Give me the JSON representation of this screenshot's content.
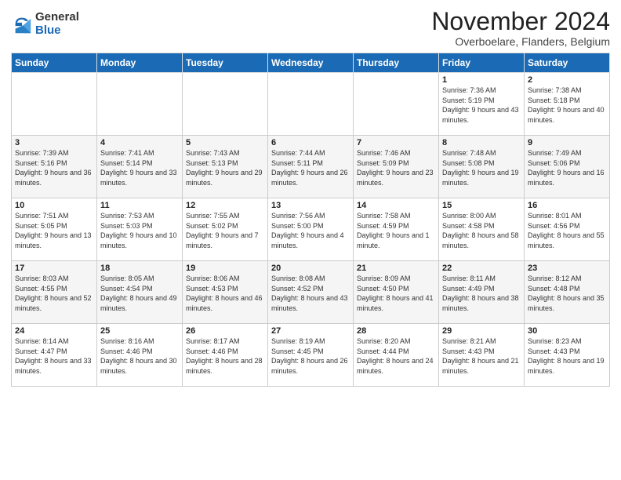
{
  "header": {
    "logo_general": "General",
    "logo_blue": "Blue",
    "title": "November 2024",
    "location": "Overboelare, Flanders, Belgium"
  },
  "days_of_week": [
    "Sunday",
    "Monday",
    "Tuesday",
    "Wednesday",
    "Thursday",
    "Friday",
    "Saturday"
  ],
  "weeks": [
    [
      {
        "day": "",
        "info": ""
      },
      {
        "day": "",
        "info": ""
      },
      {
        "day": "",
        "info": ""
      },
      {
        "day": "",
        "info": ""
      },
      {
        "day": "",
        "info": ""
      },
      {
        "day": "1",
        "info": "Sunrise: 7:36 AM\nSunset: 5:19 PM\nDaylight: 9 hours and 43 minutes."
      },
      {
        "day": "2",
        "info": "Sunrise: 7:38 AM\nSunset: 5:18 PM\nDaylight: 9 hours and 40 minutes."
      }
    ],
    [
      {
        "day": "3",
        "info": "Sunrise: 7:39 AM\nSunset: 5:16 PM\nDaylight: 9 hours and 36 minutes."
      },
      {
        "day": "4",
        "info": "Sunrise: 7:41 AM\nSunset: 5:14 PM\nDaylight: 9 hours and 33 minutes."
      },
      {
        "day": "5",
        "info": "Sunrise: 7:43 AM\nSunset: 5:13 PM\nDaylight: 9 hours and 29 minutes."
      },
      {
        "day": "6",
        "info": "Sunrise: 7:44 AM\nSunset: 5:11 PM\nDaylight: 9 hours and 26 minutes."
      },
      {
        "day": "7",
        "info": "Sunrise: 7:46 AM\nSunset: 5:09 PM\nDaylight: 9 hours and 23 minutes."
      },
      {
        "day": "8",
        "info": "Sunrise: 7:48 AM\nSunset: 5:08 PM\nDaylight: 9 hours and 19 minutes."
      },
      {
        "day": "9",
        "info": "Sunrise: 7:49 AM\nSunset: 5:06 PM\nDaylight: 9 hours and 16 minutes."
      }
    ],
    [
      {
        "day": "10",
        "info": "Sunrise: 7:51 AM\nSunset: 5:05 PM\nDaylight: 9 hours and 13 minutes."
      },
      {
        "day": "11",
        "info": "Sunrise: 7:53 AM\nSunset: 5:03 PM\nDaylight: 9 hours and 10 minutes."
      },
      {
        "day": "12",
        "info": "Sunrise: 7:55 AM\nSunset: 5:02 PM\nDaylight: 9 hours and 7 minutes."
      },
      {
        "day": "13",
        "info": "Sunrise: 7:56 AM\nSunset: 5:00 PM\nDaylight: 9 hours and 4 minutes."
      },
      {
        "day": "14",
        "info": "Sunrise: 7:58 AM\nSunset: 4:59 PM\nDaylight: 9 hours and 1 minute."
      },
      {
        "day": "15",
        "info": "Sunrise: 8:00 AM\nSunset: 4:58 PM\nDaylight: 8 hours and 58 minutes."
      },
      {
        "day": "16",
        "info": "Sunrise: 8:01 AM\nSunset: 4:56 PM\nDaylight: 8 hours and 55 minutes."
      }
    ],
    [
      {
        "day": "17",
        "info": "Sunrise: 8:03 AM\nSunset: 4:55 PM\nDaylight: 8 hours and 52 minutes."
      },
      {
        "day": "18",
        "info": "Sunrise: 8:05 AM\nSunset: 4:54 PM\nDaylight: 8 hours and 49 minutes."
      },
      {
        "day": "19",
        "info": "Sunrise: 8:06 AM\nSunset: 4:53 PM\nDaylight: 8 hours and 46 minutes."
      },
      {
        "day": "20",
        "info": "Sunrise: 8:08 AM\nSunset: 4:52 PM\nDaylight: 8 hours and 43 minutes."
      },
      {
        "day": "21",
        "info": "Sunrise: 8:09 AM\nSunset: 4:50 PM\nDaylight: 8 hours and 41 minutes."
      },
      {
        "day": "22",
        "info": "Sunrise: 8:11 AM\nSunset: 4:49 PM\nDaylight: 8 hours and 38 minutes."
      },
      {
        "day": "23",
        "info": "Sunrise: 8:12 AM\nSunset: 4:48 PM\nDaylight: 8 hours and 35 minutes."
      }
    ],
    [
      {
        "day": "24",
        "info": "Sunrise: 8:14 AM\nSunset: 4:47 PM\nDaylight: 8 hours and 33 minutes."
      },
      {
        "day": "25",
        "info": "Sunrise: 8:16 AM\nSunset: 4:46 PM\nDaylight: 8 hours and 30 minutes."
      },
      {
        "day": "26",
        "info": "Sunrise: 8:17 AM\nSunset: 4:46 PM\nDaylight: 8 hours and 28 minutes."
      },
      {
        "day": "27",
        "info": "Sunrise: 8:19 AM\nSunset: 4:45 PM\nDaylight: 8 hours and 26 minutes."
      },
      {
        "day": "28",
        "info": "Sunrise: 8:20 AM\nSunset: 4:44 PM\nDaylight: 8 hours and 24 minutes."
      },
      {
        "day": "29",
        "info": "Sunrise: 8:21 AM\nSunset: 4:43 PM\nDaylight: 8 hours and 21 minutes."
      },
      {
        "day": "30",
        "info": "Sunrise: 8:23 AM\nSunset: 4:43 PM\nDaylight: 8 hours and 19 minutes."
      }
    ]
  ]
}
